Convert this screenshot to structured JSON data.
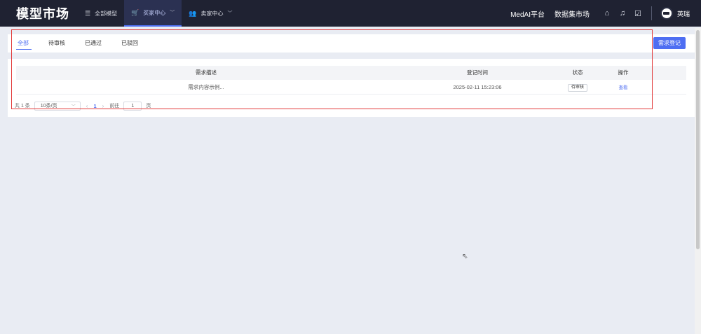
{
  "topbar": {
    "brand": "模型市场",
    "nav": [
      {
        "label": "全部模型",
        "icon": "list-icon"
      },
      {
        "label": "买家中心",
        "icon": "cart-icon",
        "active": true
      },
      {
        "label": "卖家中心",
        "icon": "users-icon"
      }
    ],
    "links": [
      "MedAI平台",
      "数据集市场"
    ],
    "icons": [
      "home-icon",
      "bell-icon",
      "edit-icon"
    ],
    "user_name": "英瑞"
  },
  "tabs": [
    "全部",
    "待审核",
    "已通过",
    "已驳回"
  ],
  "active_tab": "全部",
  "request_button": "需求登记",
  "table": {
    "headers": [
      "需求描述",
      "登记时间",
      "状态",
      "操作"
    ],
    "rows": [
      {
        "desc": "需求内容示例...",
        "time": "2025-02-11 15:23:06",
        "status": "待审核",
        "action": "查看"
      }
    ]
  },
  "pagination": {
    "total_text": "共 1 条",
    "page_size": "10条/页",
    "current_page": "1",
    "goto_label": "前往",
    "goto_value": "1",
    "page_unit": "页"
  },
  "colors": {
    "accent": "#4e6ef2",
    "topbar": "#1f2232",
    "highlight": "#e23b3b"
  }
}
